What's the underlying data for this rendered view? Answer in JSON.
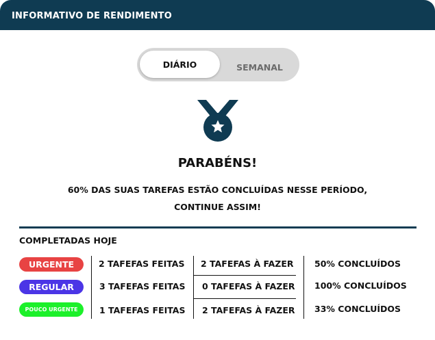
{
  "header": {
    "title": "INFORMATIVO DE RENDIMENTO"
  },
  "toggle": {
    "active_label": "DIÁRIO",
    "inactive_label": "SEMANAL"
  },
  "colors": {
    "brand": "#0f3b52",
    "urgent": "#e84343",
    "regular": "#4b35e6",
    "low": "#1cf02a"
  },
  "icons": {
    "medal": "medal-star-icon"
  },
  "congrats": {
    "title": "PARABÉNS!",
    "line1": "60% DAS SUAS TAREFAS ESTÃO CONCLUÍDAS NESSE PERÍODO,",
    "line2": "CONTINUE ASSIM!"
  },
  "completed": {
    "title": "COMPLETADAS HOJE",
    "rows": [
      {
        "priority": "URGENTE",
        "done": "2 TAFEFAS FEITAS",
        "todo": "2 TAFEFAS À FAZER",
        "percent": "50% CONCLUÍDOS"
      },
      {
        "priority": "REGULAR",
        "done": "3 TAFEFAS FEITAS",
        "todo": "0 TAFEFAS À FAZER",
        "percent": "100% CONCLUÍDOS"
      },
      {
        "priority": "POUCO URGENTE",
        "done": "1 TAFEFAS FEITAS",
        "todo": "2 TAFEFAS À FAZER",
        "percent": "33% CONCLUÍDOS"
      }
    ]
  }
}
